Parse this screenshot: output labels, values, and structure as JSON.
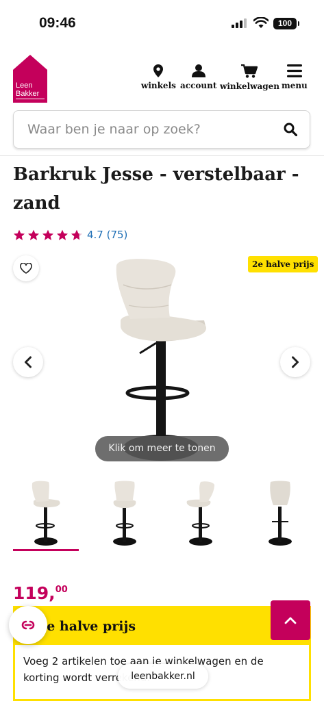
{
  "status_bar": {
    "time": "09:46",
    "battery": "100"
  },
  "brand": {
    "colors": {
      "primary": "#c4005b",
      "accent": "#ffe000",
      "link": "#1f6fb5"
    },
    "logo_line1": "Leen",
    "logo_line2": "Bakker"
  },
  "nav": [
    {
      "label": "winkels",
      "icon": "location-pin-icon"
    },
    {
      "label": "account",
      "icon": "user-icon"
    },
    {
      "label": "winkelwagen",
      "icon": "cart-icon"
    },
    {
      "label": "menu",
      "icon": "hamburger-icon"
    }
  ],
  "search": {
    "placeholder": "Waar ben je naar op zoek?"
  },
  "product": {
    "title": "Barkruk Jesse - verstelbaar - zand",
    "rating_value": 4.7,
    "rating_text": "4.7 (75)",
    "badge": "2e halve prijs",
    "tooltip": "Klik om meer te tonen",
    "thumbnail_count": 4,
    "price_main": "119,",
    "price_cents": "00"
  },
  "promo": {
    "title": "2e halve prijs",
    "text": "Voeg 2 artikelen toe aan je winkelwagen en de korting wordt verrekend."
  },
  "browser": {
    "url": "leenbakker.nl"
  }
}
